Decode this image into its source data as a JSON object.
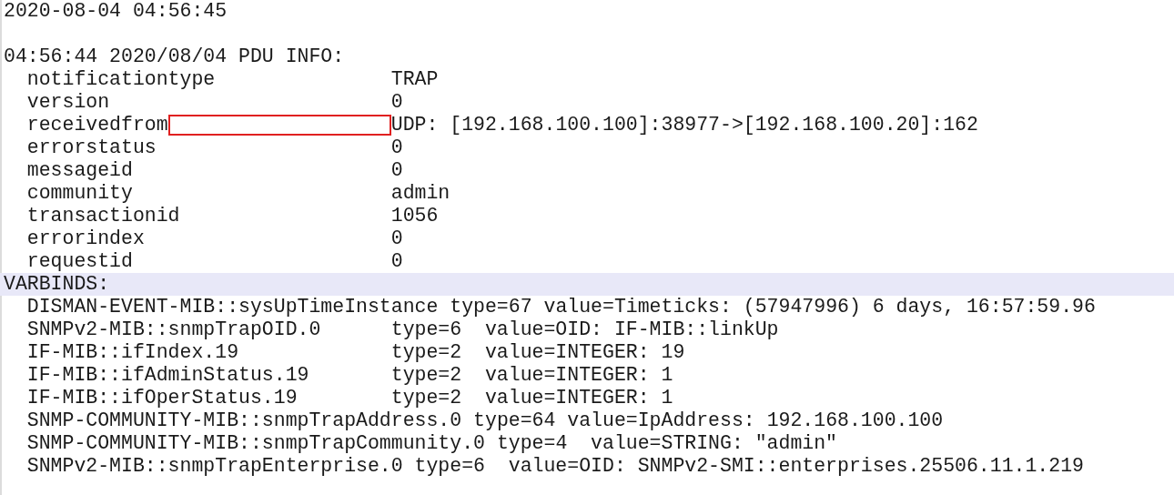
{
  "timestamp": "2020-08-04 04:56:45",
  "pdu_header": "04:56:44 2020/08/04 PDU INFO:",
  "pdu_info": [
    {
      "field": "notificationtype",
      "value": "TRAP",
      "redacted": false
    },
    {
      "field": "version",
      "value": "0",
      "redacted": false
    },
    {
      "field": "receivedfrom",
      "value": "UDP: [192.168.100.100]:38977->[192.168.100.20]:162",
      "redacted": true
    },
    {
      "field": "errorstatus",
      "value": "0",
      "redacted": false
    },
    {
      "field": "messageid",
      "value": "0",
      "redacted": false
    },
    {
      "field": "community",
      "value": "admin",
      "redacted": false
    },
    {
      "field": "transactionid",
      "value": "1056",
      "redacted": false
    },
    {
      "field": "errorindex",
      "value": "0",
      "redacted": false
    },
    {
      "field": "requestid",
      "value": "0",
      "redacted": false
    }
  ],
  "varbinds_header": {
    "text": "VARBINDS:",
    "highlighted": true
  },
  "varbinds": [
    {
      "oid": "DISMAN-EVENT-MIB::sysUpTimeInstance",
      "type": "type=67",
      "value": "value=Timeticks: (57947996) 6 days, 16:57:59.96"
    },
    {
      "oid": "SNMPv2-MIB::snmpTrapOID.0",
      "type": "type=6",
      "value": "value=OID: IF-MIB::linkUp"
    },
    {
      "oid": "IF-MIB::ifIndex.19",
      "type": "type=2",
      "value": "value=INTEGER: 19"
    },
    {
      "oid": "IF-MIB::ifAdminStatus.19",
      "type": "type=2",
      "value": "value=INTEGER: 1"
    },
    {
      "oid": "IF-MIB::ifOperStatus.19",
      "type": "type=2",
      "value": "value=INTEGER: 1"
    },
    {
      "oid": "SNMP-COMMUNITY-MIB::snmpTrapAddress.0",
      "type": "type=64",
      "value": "value=IpAddress: 192.168.100.100"
    },
    {
      "oid": "SNMP-COMMUNITY-MIB::snmpTrapCommunity.0",
      "type": "type=4",
      "value": "value=STRING: \"admin\""
    },
    {
      "oid": "SNMPv2-MIB::snmpTrapEnterprise.0",
      "type": "type=6",
      "value": "value=OID: SNMPv2-SMI::enterprises.25506.11.1.219"
    }
  ]
}
